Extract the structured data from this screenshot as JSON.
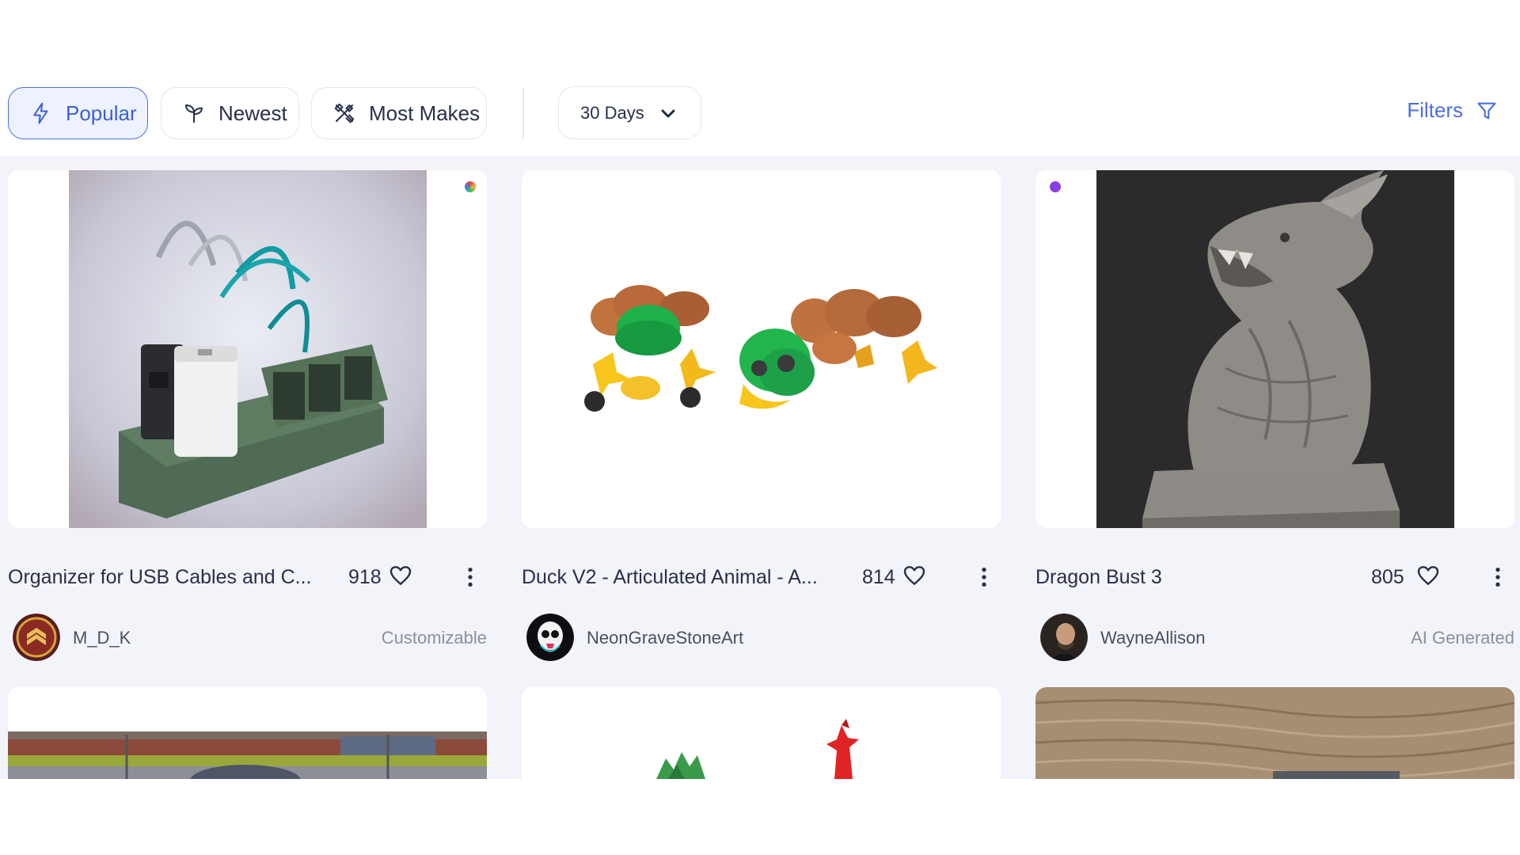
{
  "toolbar": {
    "tabs": [
      {
        "label": "Popular",
        "active": true,
        "icon": "lightning-icon"
      },
      {
        "label": "Newest",
        "active": false,
        "icon": "sprout-icon"
      },
      {
        "label": "Most Makes",
        "active": false,
        "icon": "tools-icon"
      }
    ],
    "period": "30 Days",
    "filters_label": "Filters"
  },
  "cards": [
    {
      "title": "Organizer for USB Cables and C...",
      "likes": "918",
      "author": "M_D_K",
      "tag": "Customizable"
    },
    {
      "title": "Duck V2 - Articulated Animal - A...",
      "likes": "814",
      "author": "NeonGraveStoneArt",
      "tag": ""
    },
    {
      "title": "Dragon Bust 3",
      "likes": "805",
      "author": "WayneAllison",
      "tag": "AI Generated"
    }
  ],
  "colors": {
    "accent": "#4c6fdf",
    "active_tab_bg": "#eef2ff",
    "grid_bg": "#f3f4f9",
    "text": "#27304a",
    "muted": "#8a8f9c",
    "ai_dot": "#8a3ee8"
  }
}
